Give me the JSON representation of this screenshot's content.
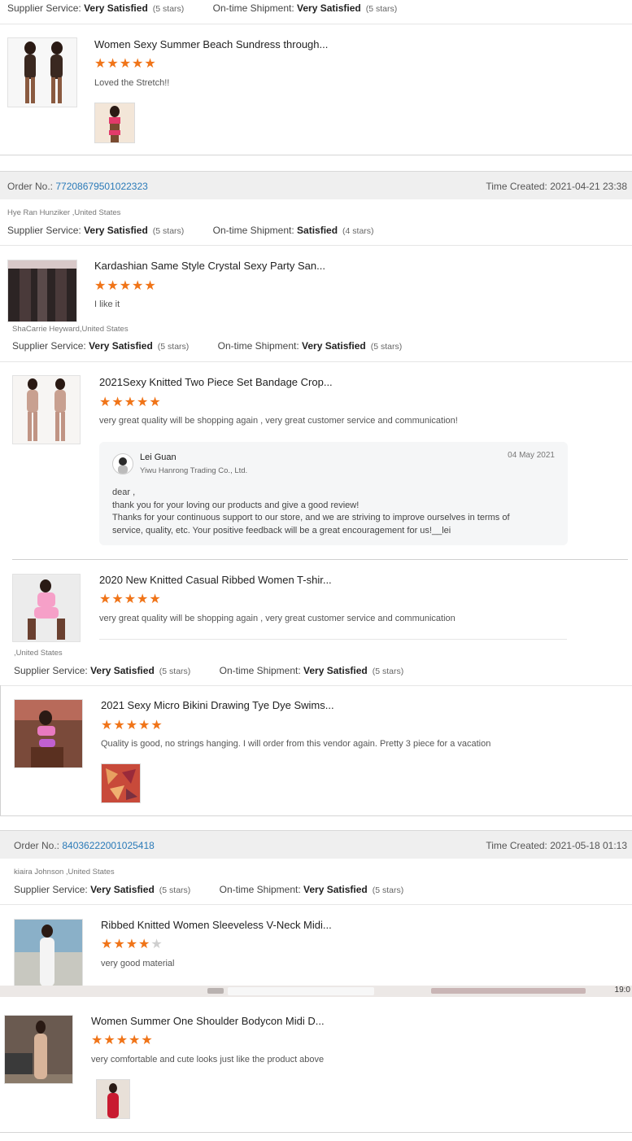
{
  "labels": {
    "supplier_service": "Supplier Service:",
    "ontime_shipment": "On-time Shipment:",
    "order_no": "Order No.:",
    "time_created": "Time Created:"
  },
  "ratings": [
    {
      "supplier_value": "Very Satisfied",
      "supplier_stars": "(5 stars)",
      "shipment_value": "Very Satisfied",
      "shipment_stars": "(5 stars)"
    },
    {
      "supplier_value": "Very Satisfied",
      "supplier_stars": "(5 stars)",
      "shipment_value": "Satisfied",
      "shipment_stars": "(4 stars)"
    },
    {
      "supplier_value": "Very Satisfied",
      "supplier_stars": "(5 stars)",
      "shipment_value": "Very Satisfied",
      "shipment_stars": "(5 stars)"
    },
    {
      "supplier_value": "Very Satisfied",
      "supplier_stars": "(5 stars)",
      "shipment_value": "Very Satisfied",
      "shipment_stars": "(5 stars)"
    },
    {
      "supplier_value": "Very Satisfied",
      "supplier_stars": "(5 stars)",
      "shipment_value": "Very Satisfied",
      "shipment_stars": "(5 stars)"
    }
  ],
  "orders": [
    {
      "number": "77208679501022323",
      "time": "2021-04-21 23:38"
    },
    {
      "number": "84036222001025418",
      "time": "2021-05-18 01:13"
    }
  ],
  "buyers": [
    "Hye Ran Hunziker ,United States",
    "ShaCarrie Heyward,United States",
    ",United States",
    "kiaira Johnson ,United States"
  ],
  "reviews": [
    {
      "title": "Women Sexy Summer Beach Sundress through...",
      "stars": 5,
      "comment": "Loved the Stretch!!"
    },
    {
      "title": "Kardashian Same Style Crystal Sexy Party San...",
      "stars": 5,
      "comment": "I like it"
    },
    {
      "title": "2021Sexy Knitted Two Piece Set Bandage Crop...",
      "stars": 5,
      "comment": "very great quality will be shopping again , very great customer service and communication!"
    },
    {
      "title": "2020 New Knitted Casual Ribbed Women T-shir...",
      "stars": 5,
      "comment": "very great quality will be shopping again , very great customer service and communication"
    },
    {
      "title": "2021 Sexy Micro Bikini Drawing Tye Dye Swims...",
      "stars": 5,
      "comment": "Quality is good, no strings hanging. I will order from this vendor again. Pretty 3 piece for a vacation"
    },
    {
      "title": "Ribbed Knitted Women Sleeveless V-Neck Midi...",
      "stars": 4,
      "comment": "very good material"
    },
    {
      "title": "Women Summer One Shoulder Bodycon Midi D...",
      "stars": 5,
      "comment": "very comfortable and cute looks just like the product above"
    }
  ],
  "reply": {
    "name": "Lei Guan",
    "company": "Yiwu Hanrong Trading Co., Ltd.",
    "date": "04 May 2021",
    "lines": [
      "dear ,",
      "thank you for your loving our products and give a good review!",
      "Thanks for your continuous support to our store, and we are striving to improve ourselves in terms of",
      "service, quality, etc. Your positive feedback will be a great encouragement for us!__lei"
    ]
  },
  "taskbar": {
    "clock": "19:0"
  },
  "colors": {
    "star": "#f07418",
    "link": "#2a7ab8",
    "order_bar": "#efefef"
  }
}
